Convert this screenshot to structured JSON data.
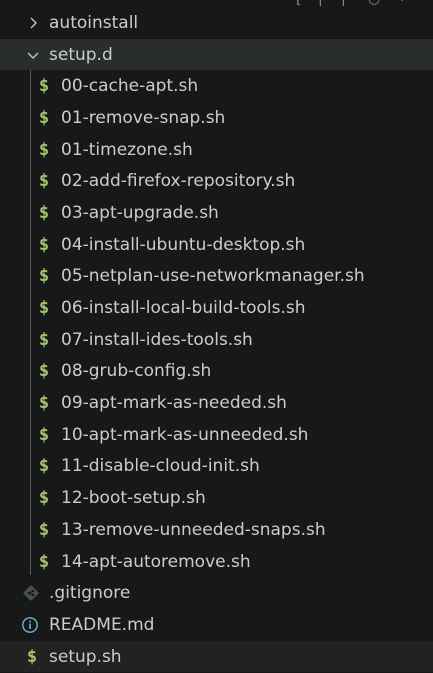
{
  "explorer": {
    "items": [
      {
        "label": "autoinstall",
        "type": "folder",
        "expanded": false
      },
      {
        "label": "setup.d",
        "type": "folder",
        "expanded": true
      },
      {
        "label": "00-cache-apt.sh",
        "type": "shell",
        "depth": 1
      },
      {
        "label": "01-remove-snap.sh",
        "type": "shell",
        "depth": 1
      },
      {
        "label": "01-timezone.sh",
        "type": "shell",
        "depth": 1
      },
      {
        "label": "02-add-firefox-repository.sh",
        "type": "shell",
        "depth": 1
      },
      {
        "label": "03-apt-upgrade.sh",
        "type": "shell",
        "depth": 1
      },
      {
        "label": "04-install-ubuntu-desktop.sh",
        "type": "shell",
        "depth": 1
      },
      {
        "label": "05-netplan-use-networkmanager.sh",
        "type": "shell",
        "depth": 1
      },
      {
        "label": "06-install-local-build-tools.sh",
        "type": "shell",
        "depth": 1
      },
      {
        "label": "07-install-ides-tools.sh",
        "type": "shell",
        "depth": 1
      },
      {
        "label": "08-grub-config.sh",
        "type": "shell",
        "depth": 1
      },
      {
        "label": "09-apt-mark-as-needed.sh",
        "type": "shell",
        "depth": 1
      },
      {
        "label": "10-apt-mark-as-unneeded.sh",
        "type": "shell",
        "depth": 1
      },
      {
        "label": "11-disable-cloud-init.sh",
        "type": "shell",
        "depth": 1
      },
      {
        "label": "12-boot-setup.sh",
        "type": "shell",
        "depth": 1
      },
      {
        "label": "13-remove-unneeded-snaps.sh",
        "type": "shell",
        "depth": 1
      },
      {
        "label": "14-apt-autoremove.sh",
        "type": "shell",
        "depth": 1
      },
      {
        "label": ".gitignore",
        "type": "git"
      },
      {
        "label": "README.md",
        "type": "markdown"
      },
      {
        "label": "setup.sh",
        "type": "shell"
      }
    ],
    "icons": {
      "shell_glyph": "$",
      "chevron_right": "chevron-right-icon",
      "chevron_down": "chevron-down-icon",
      "git": "git-icon",
      "info": "info-icon"
    },
    "colors": {
      "background": "#181818",
      "text": "#cccccc",
      "shell_icon": "#a6c86b",
      "selected_row": "#2a2d2e",
      "indent_guide": "#585858"
    }
  }
}
